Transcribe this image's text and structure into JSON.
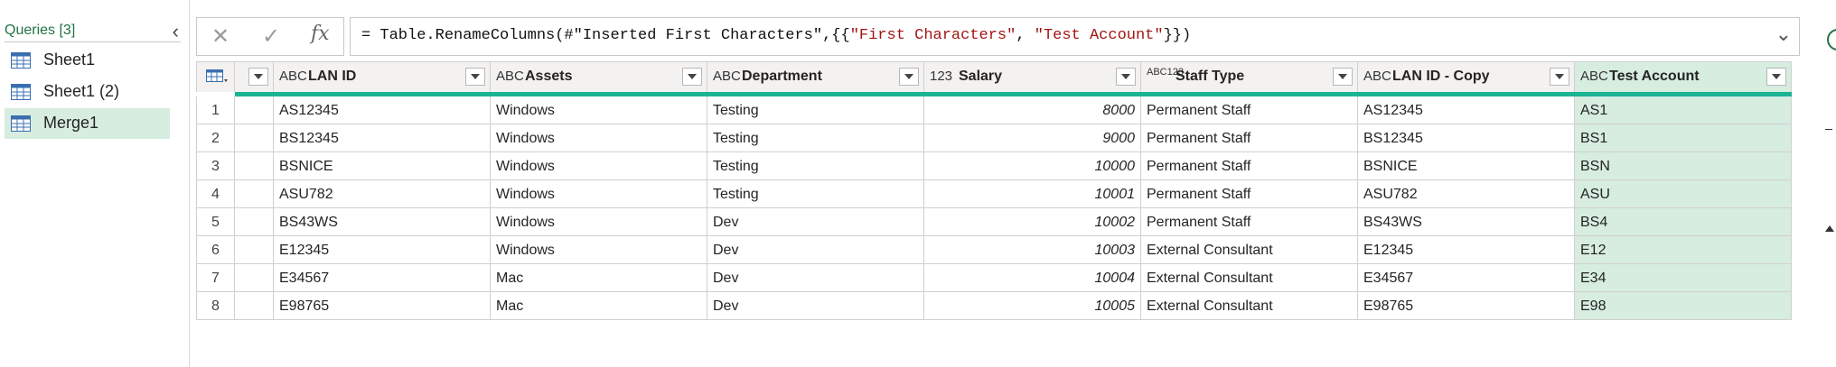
{
  "queries_pane": {
    "header": "Queries [3]",
    "items": [
      {
        "label": "Sheet1",
        "selected": false
      },
      {
        "label": "Sheet1 (2)",
        "selected": false
      },
      {
        "label": "Merge1",
        "selected": true
      }
    ]
  },
  "formula_bar": {
    "formula_prefix": "= Table.RenameColumns(#\"Inserted First Characters\",{{",
    "string_1": "\"First Characters\"",
    "separator": ", ",
    "string_2": "\"Test Account\"",
    "formula_suffix": "}})"
  },
  "grid": {
    "columns": [
      {
        "type_icon": "ABC",
        "name": "LAN ID"
      },
      {
        "type_icon": "ABC",
        "name": "Assets"
      },
      {
        "type_icon": "ABC",
        "name": "Department"
      },
      {
        "type_icon": "123",
        "name": "Salary"
      },
      {
        "type_icon": "ABC123",
        "name": "Staff Type"
      },
      {
        "type_icon": "ABC",
        "name": "LAN ID - Copy"
      },
      {
        "type_icon": "ABC",
        "name": "Test Account"
      }
    ],
    "rows": [
      {
        "n": "1",
        "lan_id": "AS12345",
        "assets": "Windows",
        "department": "Testing",
        "salary": "8000",
        "staff_type": "Permanent Staff",
        "lan_copy": "AS12345",
        "test_account": "AS1"
      },
      {
        "n": "2",
        "lan_id": "BS12345",
        "assets": "Windows",
        "department": "Testing",
        "salary": "9000",
        "staff_type": "Permanent Staff",
        "lan_copy": "BS12345",
        "test_account": "BS1"
      },
      {
        "n": "3",
        "lan_id": "BSNICE",
        "assets": "Windows",
        "department": "Testing",
        "salary": "10000",
        "staff_type": "Permanent Staff",
        "lan_copy": "BSNICE",
        "test_account": "BSN"
      },
      {
        "n": "4",
        "lan_id": "ASU782",
        "assets": "Windows",
        "department": "Testing",
        "salary": "10001",
        "staff_type": "Permanent Staff",
        "lan_copy": "ASU782",
        "test_account": "ASU"
      },
      {
        "n": "5",
        "lan_id": "BS43WS",
        "assets": "Windows",
        "department": "Dev",
        "salary": "10002",
        "staff_type": "Permanent Staff",
        "lan_copy": "BS43WS",
        "test_account": "BS4"
      },
      {
        "n": "6",
        "lan_id": "E12345",
        "assets": "Windows",
        "department": "Dev",
        "salary": "10003",
        "staff_type": "External Consultant",
        "lan_copy": "E12345",
        "test_account": "E12"
      },
      {
        "n": "7",
        "lan_id": "E34567",
        "assets": "Mac",
        "department": "Dev",
        "salary": "10004",
        "staff_type": "External Consultant",
        "lan_copy": "E34567",
        "test_account": "E34"
      },
      {
        "n": "8",
        "lan_id": "E98765",
        "assets": "Mac",
        "department": "Dev",
        "salary": "10005",
        "staff_type": "External Consultant",
        "lan_copy": "E98765",
        "test_account": "E98"
      }
    ]
  },
  "colors": {
    "accent_green": "#217346",
    "selection_green": "#d6ede0",
    "quality_bar": "#1ab394",
    "string_red": "#a31515"
  }
}
